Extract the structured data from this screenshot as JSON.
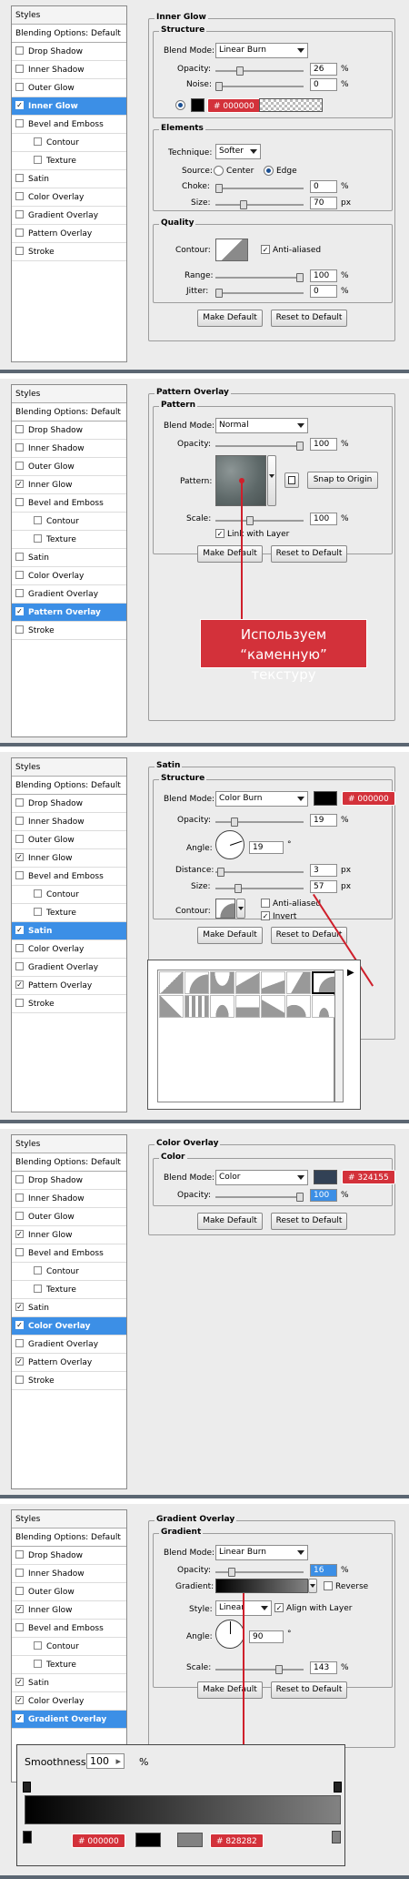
{
  "styles_list": {
    "header": "Styles",
    "blending": "Blending Options: Default",
    "items": [
      "Drop Shadow",
      "Inner Shadow",
      "Outer Glow",
      "Inner Glow",
      "Bevel and Emboss",
      "Contour",
      "Texture",
      "Satin",
      "Color Overlay",
      "Gradient Overlay",
      "Pattern Overlay",
      "Stroke"
    ]
  },
  "check_glyph": "✓",
  "buttons": {
    "make_default": "Make Default",
    "reset_default": "Reset to Default"
  },
  "common": {
    "blend_mode": "Blend Mode:",
    "opacity": "Opacity:",
    "percent": "%",
    "px": "px"
  },
  "inner_glow": {
    "title": "Inner Glow",
    "structure_title": "Structure",
    "blend_mode": "Linear Burn",
    "opacity": "26",
    "noise_label": "Noise:",
    "noise": "0",
    "color_tag": "# 000000",
    "elements_title": "Elements",
    "technique_label": "Technique:",
    "technique": "Softer",
    "source_label": "Source:",
    "center_label": "Center",
    "edge_label": "Edge",
    "choke_label": "Choke:",
    "choke": "0",
    "size_label": "Size:",
    "size": "70",
    "quality_title": "Quality",
    "contour_label": "Contour:",
    "anti_aliased": "Anti-aliased",
    "range_label": "Range:",
    "range": "100",
    "jitter_label": "Jitter:",
    "jitter": "0"
  },
  "pattern_overlay": {
    "title": "Pattern Overlay",
    "group_title": "Pattern",
    "blend_mode": "Normal",
    "opacity": "100",
    "pattern_label": "Pattern:",
    "snap_button": "Snap to Origin",
    "scale_label": "Scale:",
    "scale": "100",
    "link_label": "Link with Layer",
    "callout": "Используем “каменную” текстуру"
  },
  "satin": {
    "title": "Satin",
    "structure_title": "Structure",
    "blend_mode": "Color Burn",
    "color_tag": "# 000000",
    "opacity": "19",
    "angle_label": "Angle:",
    "angle": "19",
    "degree": "°",
    "distance_label": "Distance:",
    "distance": "3",
    "size_label": "Size:",
    "size": "57",
    "contour_label": "Contour:",
    "anti_aliased": "Anti-aliased",
    "invert": "Invert",
    "picker_arrow": "▶"
  },
  "color_overlay": {
    "title": "Color Overlay",
    "group_title": "Color",
    "blend_mode": "Color",
    "color_tag": "# 324155",
    "opacity": "100",
    "swatch_color": "#324155"
  },
  "gradient_overlay": {
    "title": "Gradient Overlay",
    "group_title": "Gradient",
    "blend_mode": "Linear Burn",
    "opacity": "16",
    "gradient_label": "Gradient:",
    "reverse_label": "Reverse",
    "style_label": "Style:",
    "style": "Linear",
    "align_label": "Align with Layer",
    "angle_label": "Angle:",
    "angle": "90",
    "degree": "°",
    "scale_label": "Scale:",
    "scale": "143",
    "smoothness_label": "Smoothness:",
    "smoothness": "100",
    "stepper_arrow": "▸",
    "percent": "%",
    "stop_left_tag": "# 000000",
    "stop_right_tag": "# 828282"
  }
}
